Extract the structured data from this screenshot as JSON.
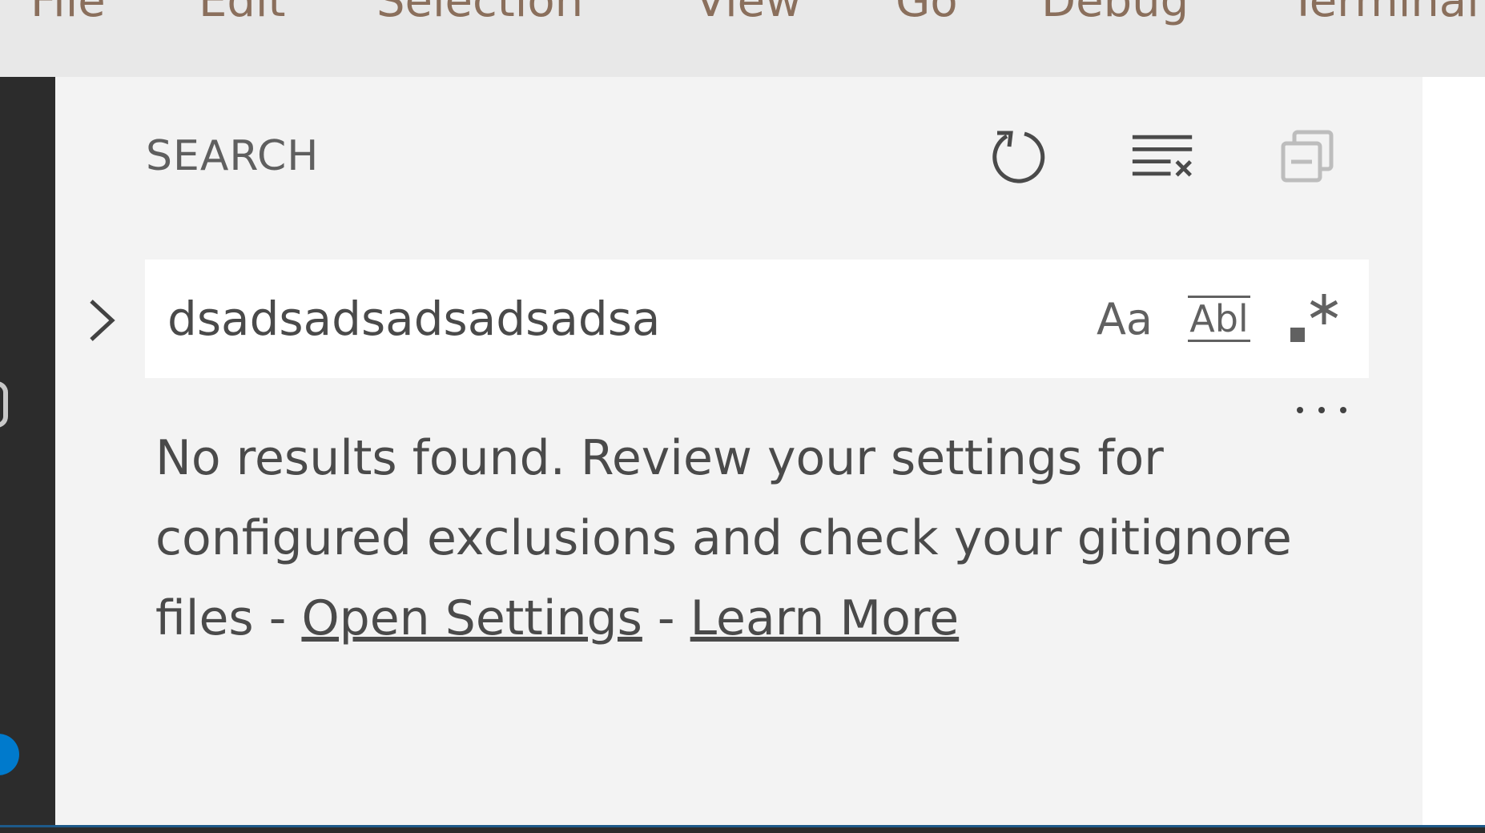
{
  "menubar": {
    "items": [
      "File",
      "Edit",
      "Selection",
      "View",
      "Go",
      "Debug",
      "Terminal"
    ]
  },
  "search": {
    "title": "SEARCH",
    "query": "dsadsadsadsadsadsa",
    "match_case_label": "Aa",
    "whole_word_label": "Abl",
    "message_prefix": "No results found. Review your settings for configured exclusions and check your gitignore files - ",
    "open_settings": "Open Settings",
    "separator": " - ",
    "learn_more": "Learn More"
  },
  "icons": {
    "refresh": "refresh-icon",
    "clear": "clear-results-icon",
    "collapse": "collapse-all-icon",
    "toggle_replace": "chevron-right-icon",
    "regex": "regex-icon",
    "more": "ellipsis-icon"
  },
  "colors": {
    "sidebar_bg": "#f3f3f3",
    "activitybar_bg": "#2c2c2c",
    "badge": "#007acc",
    "menubar_bg": "#e8e8e8"
  }
}
